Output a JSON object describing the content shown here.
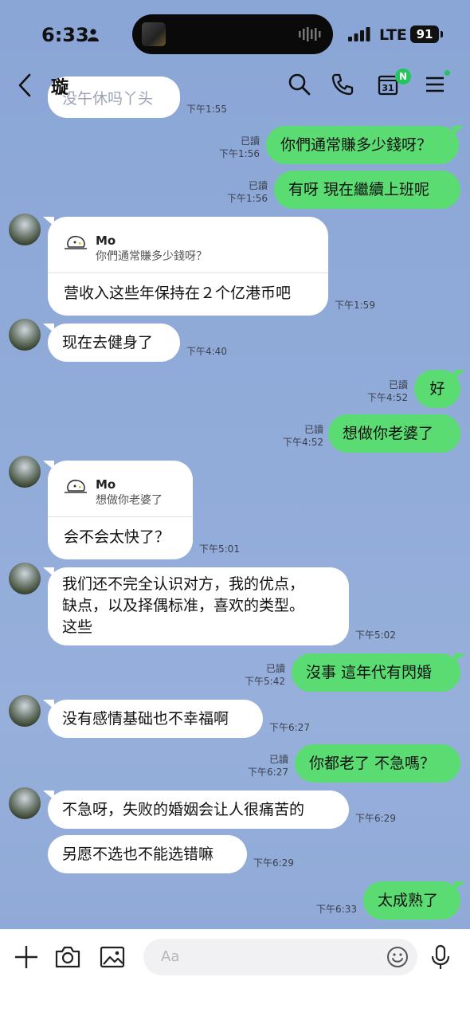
{
  "status_bar": {
    "time": "6:33",
    "network": "LTE",
    "battery": "91"
  },
  "header": {
    "title": "璇",
    "calendar_day": "31",
    "calendar_badge": "N"
  },
  "messages": [
    {
      "id": "m0",
      "text": "没午休吗丫头",
      "time": "下午1:55",
      "side": "in"
    },
    {
      "id": "m1",
      "text": "你們通常賺多少錢呀？",
      "read": "已讀",
      "time": "下午1:56",
      "side": "out"
    },
    {
      "id": "m2",
      "text": "有呀 現在繼續上班呢",
      "read": "已讀",
      "time": "下午1:56",
      "side": "out"
    },
    {
      "id": "m3",
      "quote_name": "Mo",
      "quote_text": "你們通常賺多少錢呀？",
      "text": "营收入这些年保持在２个亿港币吧",
      "time": "下午1:59",
      "side": "in"
    },
    {
      "id": "m4",
      "text": "现在去健身了",
      "time": "下午4:40",
      "side": "in"
    },
    {
      "id": "m5",
      "text": "好",
      "read": "已讀",
      "time": "下午4:52",
      "side": "out"
    },
    {
      "id": "m6",
      "text": "想做你老婆了",
      "read": "已讀",
      "time": "下午4:52",
      "side": "out"
    },
    {
      "id": "m7",
      "quote_name": "Mo",
      "quote_text": "想做你老婆了",
      "text": "会不会太快了？",
      "time": "下午5:01",
      "side": "in"
    },
    {
      "id": "m8",
      "lines": [
        "我们还不完全认识对方，我的优点，",
        "缺点，以及择偶标准，喜欢的类型。",
        "这些"
      ],
      "time": "下午5:02",
      "side": "in"
    },
    {
      "id": "m9",
      "text": "沒事 這年代有閃婚",
      "read": "已讀",
      "time": "下午5:42",
      "side": "out"
    },
    {
      "id": "m10",
      "text": "没有感情基础也不幸福啊",
      "time": "下午6:27",
      "side": "in"
    },
    {
      "id": "m11",
      "text": "你都老了 不急嗎？",
      "read": "已讀",
      "time": "下午6:27",
      "side": "out"
    },
    {
      "id": "m12",
      "text": "不急呀，失败的婚姻会让人很痛苦的",
      "time": "下午6:29",
      "side": "in"
    },
    {
      "id": "m13",
      "text": "另愿不选也不能选错嘛",
      "time": "下午6:29",
      "side": "in"
    },
    {
      "id": "m14",
      "text": "太成熟了",
      "time": "下午6:33",
      "side": "out"
    }
  ],
  "input_bar": {
    "placeholder": "Aa"
  }
}
